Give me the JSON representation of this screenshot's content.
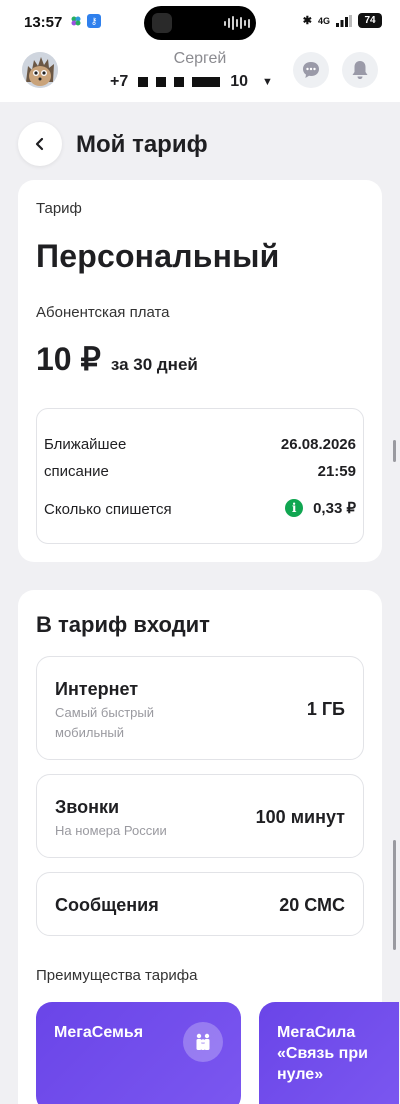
{
  "status_bar": {
    "time": "13:57",
    "network": "4G",
    "battery": "74"
  },
  "header": {
    "user_name": "Сергей",
    "phone_prefix": "+7",
    "phone_suffix": "10"
  },
  "page": {
    "title": "Мой тариф"
  },
  "tariff_card": {
    "label": "Тариф",
    "name": "Персональный",
    "fee_label": "Абонентская плата",
    "fee_amount": "10 ₽",
    "fee_period": "за 30 дней",
    "next_charge_label": "Ближайшее списание",
    "next_charge_date": "26.08.2026",
    "next_charge_time": "21:59",
    "charge_amount_label": "Сколько спишется",
    "charge_amount": "0,33 ₽"
  },
  "includes": {
    "title": "В тариф входит",
    "packages": [
      {
        "name": "Интернет",
        "subtitle": "Самый быстрый мобильный",
        "value": "1 ГБ"
      },
      {
        "name": "Звонки",
        "subtitle": "На номера России",
        "value": "100 минут"
      },
      {
        "name": "Сообщения",
        "subtitle": "",
        "value": "20 СМС"
      }
    ],
    "benefits_label": "Преимущества тарифа",
    "benefits": [
      {
        "title": "МегаСемья"
      },
      {
        "title": "МегаСила «Связь при нуле»"
      }
    ]
  },
  "colors": {
    "accent_green": "#10a651",
    "promo_purple": "#6a45e8",
    "background": "#f0f0f3"
  }
}
